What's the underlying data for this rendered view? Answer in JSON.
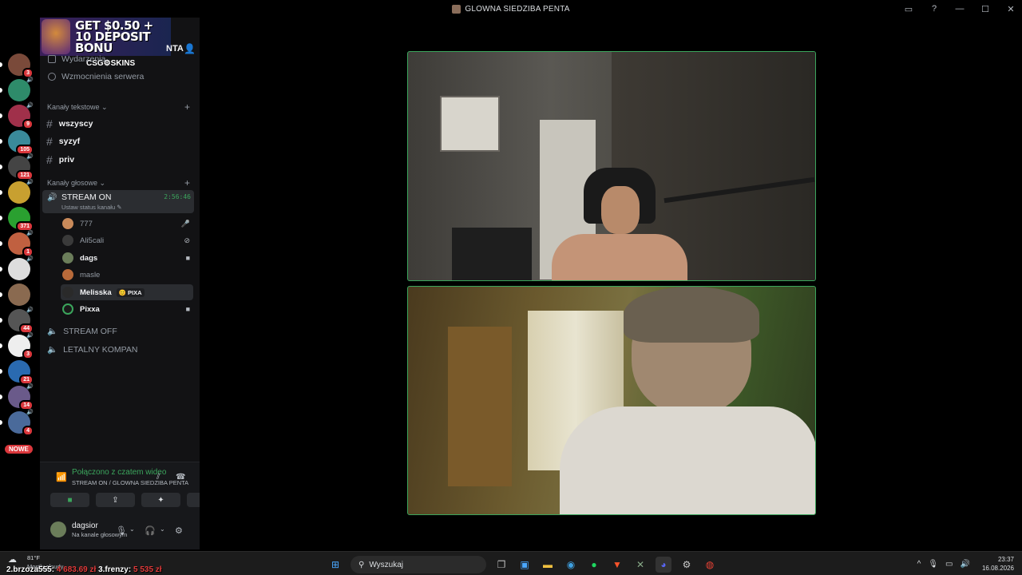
{
  "window": {
    "title": "GLOWNA SIEDZIBA PENTA"
  },
  "ad": {
    "headline": "GET $0.50 + 10 DEPOSIT BONU",
    "brand": "CSG⚙SKINS"
  },
  "server": {
    "name": "NTA"
  },
  "servers": [
    {
      "badge": "3"
    },
    {
      "badge": ""
    },
    {
      "badge": "9"
    },
    {
      "badge": "105"
    },
    {
      "badge": "121"
    },
    {
      "badge": ""
    },
    {
      "badge": "371"
    },
    {
      "badge": "1"
    },
    {
      "badge": ""
    },
    {
      "badge": ""
    },
    {
      "badge": "44"
    },
    {
      "badge": "3"
    },
    {
      "badge": "21"
    },
    {
      "badge": "14"
    },
    {
      "badge": "4"
    }
  ],
  "server_new": "NOWE",
  "nav": {
    "events": "Wydarzenia",
    "boosts": "Wzmocnienia serwera"
  },
  "text_category": "Kanały tekstowe",
  "text_channels": [
    "wszyscy",
    "syzyf",
    "priv"
  ],
  "voice_category": "Kanały głosowe",
  "voice_active": {
    "name": "STREAM ON",
    "status": "Ustaw status kanału",
    "timer": "2:56:46"
  },
  "members": [
    {
      "name": "777"
    },
    {
      "name": "Ali5cali"
    },
    {
      "name": "dags"
    },
    {
      "name": "masle"
    },
    {
      "name": "Melisska",
      "tag": "😊 PIXA"
    },
    {
      "name": "Pixxa"
    }
  ],
  "voice_other": [
    "STREAM OFF",
    "LETALNY KOMPAN"
  ],
  "rtc": {
    "status": "Połączono z czatem wideo",
    "channel": "STREAM ON / GLOWNA SIEDZIBA PENTA"
  },
  "user": {
    "name": "dagsior",
    "status": "Na kanale głosowym"
  },
  "taskbar": {
    "weather_temp": "81°F",
    "weather_cond": "Mostly cloudy",
    "search": "Wyszukaj",
    "time": "23:37",
    "date": "16.08.2026"
  },
  "overlay": {
    "p1": "2.brzoza555:",
    "v1": "4 683.69 zł",
    "p2": "3.frenzy:",
    "v2": "5 535 zł"
  },
  "colors": {
    "accent_green": "#3ba55c",
    "badge_red": "#da373c"
  }
}
